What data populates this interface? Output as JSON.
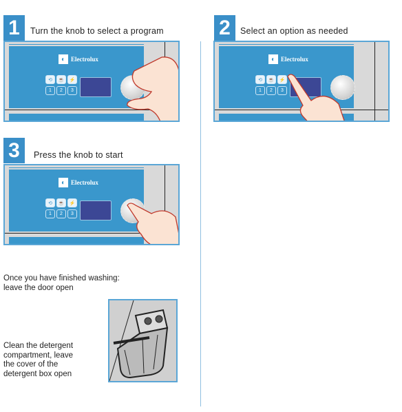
{
  "steps": [
    {
      "number": "1",
      "title": "Turn the knob to select a program"
    },
    {
      "number": "2",
      "title": "Select an option as needed"
    },
    {
      "number": "3",
      "title": "Press the knob to start"
    }
  ],
  "panel": {
    "brand": "Electrolux",
    "buttons": [
      "⟲",
      "☕",
      "⚡",
      "1",
      "2",
      "3"
    ]
  },
  "finish_text": [
    "Once you have finished washing:",
    "leave the door open"
  ],
  "clean_text": [
    "Clean the detergent",
    "compartment, leave",
    "the cover of the",
    "detergent box open"
  ],
  "colors": {
    "accent": "#3a8fc8",
    "panel_face": "#3a97cc",
    "display": "#3c4795"
  }
}
